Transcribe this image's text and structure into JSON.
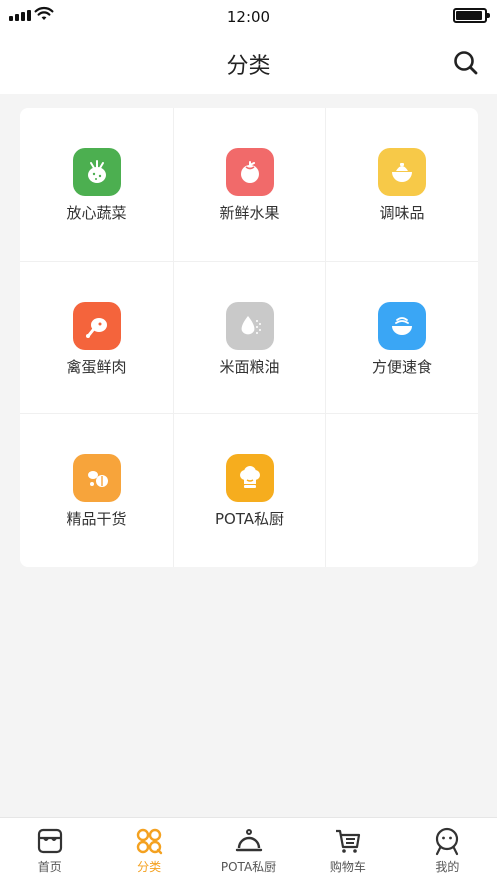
{
  "status_bar": {
    "time": "12:00"
  },
  "nav": {
    "title": "分类"
  },
  "categories": [
    {
      "label": "放心蔬菜",
      "icon": "carrot-icon",
      "color": "#4caf50"
    },
    {
      "label": "新鲜水果",
      "icon": "tomato-icon",
      "color": "#f16a6a"
    },
    {
      "label": "调味品",
      "icon": "seasoning-bowl-icon",
      "color": "#f7c948"
    },
    {
      "label": "禽蛋鲜肉",
      "icon": "drumstick-icon",
      "color": "#f4643c"
    },
    {
      "label": "米面粮油",
      "icon": "oil-drop-icon",
      "color": "#c9c9c9"
    },
    {
      "label": "方便速食",
      "icon": "noodle-bowl-icon",
      "color": "#3aa6f5"
    },
    {
      "label": "精品干货",
      "icon": "dried-goods-icon",
      "color": "#f7a43b"
    },
    {
      "label": "POTA私厨",
      "icon": "chef-hat-icon",
      "color": "#f6ad1e"
    }
  ],
  "tabs": [
    {
      "label": "首页",
      "icon": "store-icon",
      "active": false
    },
    {
      "label": "分类",
      "icon": "category-grid-icon",
      "active": true
    },
    {
      "label": "POTA私厨",
      "icon": "cloche-icon",
      "active": false
    },
    {
      "label": "购物车",
      "icon": "cart-icon",
      "active": false
    },
    {
      "label": "我的",
      "icon": "user-face-icon",
      "active": false
    }
  ],
  "colors": {
    "accent": "#f4a120",
    "background": "#f4f4f4"
  }
}
